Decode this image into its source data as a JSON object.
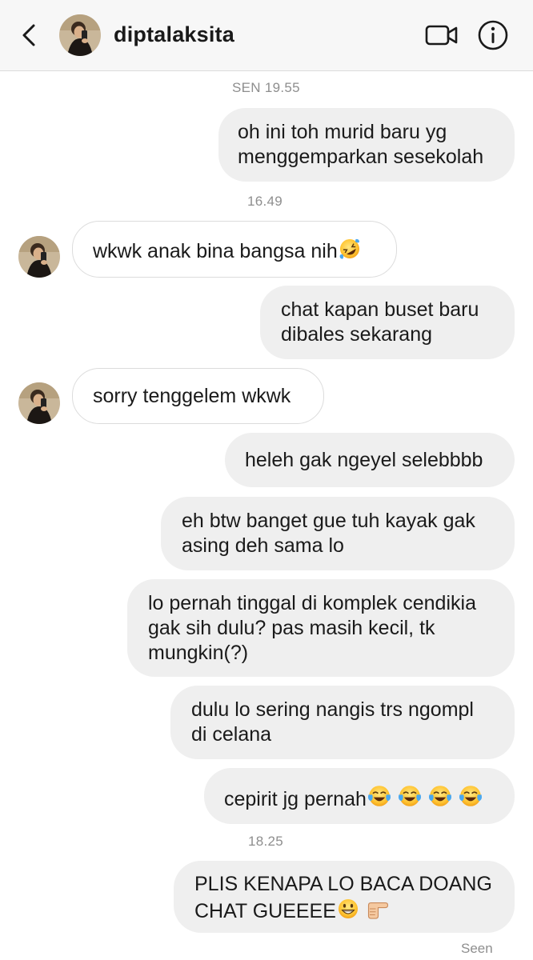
{
  "header": {
    "username": "diptalaksita",
    "back_icon": "chevron-left-icon",
    "video_icon": "video-camera-icon",
    "info_icon": "info-icon"
  },
  "timestamps": [
    "SEN 19.55",
    "16.49",
    "18.25"
  ],
  "messages": [
    {
      "side": "out",
      "lines": [
        "oh ini toh murid baru yg",
        "menggemparkan sesekolah"
      ]
    },
    {
      "side": "in",
      "text": "wkwk anak bina bangsa nih",
      "emoji": "rolling-on-floor-laughing"
    },
    {
      "side": "out",
      "lines": [
        "chat kapan buset baru",
        "dibales sekarang"
      ]
    },
    {
      "side": "in",
      "text": "sorry tenggelem wkwk"
    },
    {
      "side": "out",
      "lines": [
        "heleh gak ngeyel selebbbb"
      ]
    },
    {
      "side": "out",
      "lines": [
        "eh btw banget gue tuh kayak gak",
        "asing deh sama lo"
      ]
    },
    {
      "side": "out",
      "lines": [
        "lo pernah tinggal di komplek cendikia",
        "gak sih dulu? pas masih kecil, tk",
        "mungkin(?)"
      ]
    },
    {
      "side": "out",
      "lines": [
        "dulu lo sering nangis trs ngompl",
        "di celana"
      ]
    },
    {
      "side": "out",
      "text": "cepirit jg pernah",
      "emoji": "face-with-tears-of-joy x4"
    },
    {
      "side": "out",
      "lines": [
        "PLIS KENAPA LO BACA DOANG",
        "CHAT GUEEEE"
      ],
      "emoji": "grinning-face, backhand-index-pointing-right"
    }
  ],
  "status": {
    "seen": "Seen"
  },
  "colors": {
    "outgoing_bubble": "#efefef",
    "incoming_border": "#dcdcdc",
    "text": "#1a1a1a",
    "timestamp": "#8e8e8e"
  }
}
